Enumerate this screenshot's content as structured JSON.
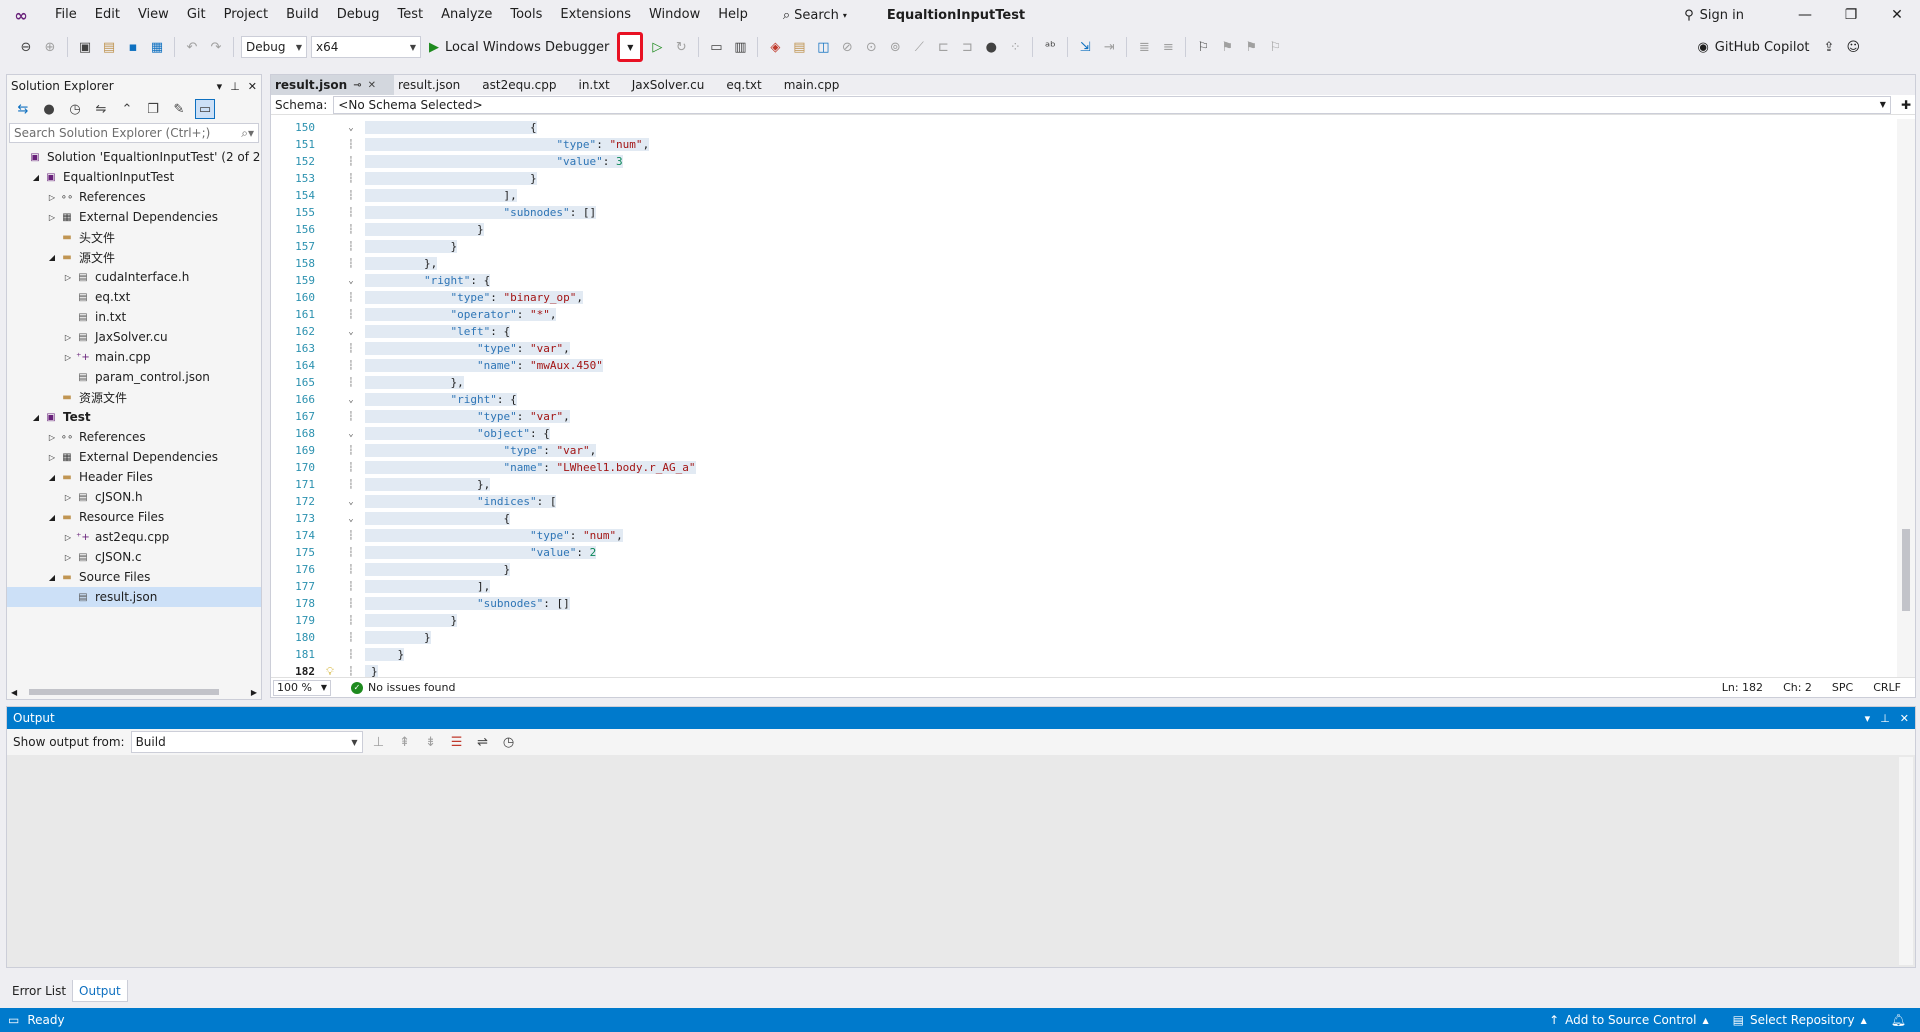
{
  "menu": {
    "items": [
      "File",
      "Edit",
      "View",
      "Git",
      "Project",
      "Build",
      "Debug",
      "Test",
      "Analyze",
      "Tools",
      "Extensions",
      "Window",
      "Help"
    ],
    "search_label": "Search",
    "project_title": "EqualtionInputTest",
    "sign_in": "Sign in"
  },
  "toolbar": {
    "config": "Debug",
    "platform": "x64",
    "run_label": "Local Windows Debugger",
    "copilot_label": "GitHub Copilot"
  },
  "solution_explorer": {
    "title": "Solution Explorer",
    "search_placeholder": "Search Solution Explorer (Ctrl+;)",
    "tree": [
      {
        "label": "Solution 'EqualtionInputTest' (2 of 2 projects)",
        "depth": 0,
        "twisty": "",
        "icon": "solution-icon",
        "bold": false
      },
      {
        "label": "EqualtionInputTest",
        "depth": 1,
        "twisty": "open",
        "icon": "project-icon",
        "bold": false
      },
      {
        "label": "References",
        "depth": 2,
        "twisty": "closed",
        "icon": "references-icon",
        "bold": false
      },
      {
        "label": "External Dependencies",
        "depth": 2,
        "twisty": "closed",
        "icon": "external-deps-icon",
        "bold": false
      },
      {
        "label": "头文件",
        "depth": 2,
        "twisty": "",
        "icon": "folder-icon",
        "bold": false
      },
      {
        "label": "源文件",
        "depth": 2,
        "twisty": "open",
        "icon": "folder-icon",
        "bold": false
      },
      {
        "label": "cudaInterface.h",
        "depth": 3,
        "twisty": "closed",
        "icon": "file-icon",
        "bold": false
      },
      {
        "label": "eq.txt",
        "depth": 3,
        "twisty": "",
        "icon": "file-icon",
        "bold": false
      },
      {
        "label": "in.txt",
        "depth": 3,
        "twisty": "",
        "icon": "file-icon",
        "bold": false
      },
      {
        "label": "JaxSolver.cu",
        "depth": 3,
        "twisty": "closed",
        "icon": "file-icon",
        "bold": false
      },
      {
        "label": "main.cpp",
        "depth": 3,
        "twisty": "closed",
        "icon": "cpp-icon",
        "bold": false
      },
      {
        "label": "param_control.json",
        "depth": 3,
        "twisty": "",
        "icon": "file-icon",
        "bold": false
      },
      {
        "label": "资源文件",
        "depth": 2,
        "twisty": "",
        "icon": "folder-icon",
        "bold": false
      },
      {
        "label": "Test",
        "depth": 1,
        "twisty": "open",
        "icon": "project-icon",
        "bold": true
      },
      {
        "label": "References",
        "depth": 2,
        "twisty": "closed",
        "icon": "references-icon",
        "bold": false
      },
      {
        "label": "External Dependencies",
        "depth": 2,
        "twisty": "closed",
        "icon": "external-deps-icon",
        "bold": false
      },
      {
        "label": "Header Files",
        "depth": 2,
        "twisty": "open",
        "icon": "folder-icon",
        "bold": false
      },
      {
        "label": "cJSON.h",
        "depth": 3,
        "twisty": "closed",
        "icon": "file-icon",
        "bold": false
      },
      {
        "label": "Resource Files",
        "depth": 2,
        "twisty": "open",
        "icon": "folder-icon",
        "bold": false
      },
      {
        "label": "ast2equ.cpp",
        "depth": 3,
        "twisty": "closed",
        "icon": "cpp-icon",
        "bold": false
      },
      {
        "label": "cJSON.c",
        "depth": 3,
        "twisty": "closed",
        "icon": "file-icon",
        "bold": false
      },
      {
        "label": "Source Files",
        "depth": 2,
        "twisty": "open",
        "icon": "folder-icon",
        "bold": false
      },
      {
        "label": "result.json",
        "depth": 3,
        "twisty": "",
        "icon": "file-icon",
        "bold": false,
        "selected": true
      }
    ]
  },
  "editor": {
    "tabs": [
      {
        "label": "result.json",
        "active": true
      },
      {
        "label": "result.json",
        "active": false
      },
      {
        "label": "ast2equ.cpp",
        "active": false
      },
      {
        "label": "in.txt",
        "active": false
      },
      {
        "label": "JaxSolver.cu",
        "active": false
      },
      {
        "label": "eq.txt",
        "active": false
      },
      {
        "label": "main.cpp",
        "active": false
      }
    ],
    "schema_label": "Schema:",
    "schema_value": "<No Schema Selected>",
    "lines": [
      {
        "n": "150",
        "fold": "v",
        "text": "                        {"
      },
      {
        "n": "151",
        "fold": "",
        "text": "                            \"type\": \"num\","
      },
      {
        "n": "152",
        "fold": "",
        "text": "                            \"value\": 3"
      },
      {
        "n": "153",
        "fold": "",
        "text": "                        }"
      },
      {
        "n": "154",
        "fold": "",
        "text": "                    ],"
      },
      {
        "n": "155",
        "fold": "",
        "text": "                    \"subnodes\": []"
      },
      {
        "n": "156",
        "fold": "",
        "text": "                }"
      },
      {
        "n": "157",
        "fold": "",
        "text": "            }"
      },
      {
        "n": "158",
        "fold": "",
        "text": "        },"
      },
      {
        "n": "159",
        "fold": "v",
        "text": "        \"right\": {"
      },
      {
        "n": "160",
        "fold": "",
        "text": "            \"type\": \"binary_op\","
      },
      {
        "n": "161",
        "fold": "",
        "text": "            \"operator\": \"*\","
      },
      {
        "n": "162",
        "fold": "v",
        "text": "            \"left\": {"
      },
      {
        "n": "163",
        "fold": "",
        "text": "                \"type\": \"var\","
      },
      {
        "n": "164",
        "fold": "",
        "text": "                \"name\": \"mwAux.450\""
      },
      {
        "n": "165",
        "fold": "",
        "text": "            },"
      },
      {
        "n": "166",
        "fold": "v",
        "text": "            \"right\": {"
      },
      {
        "n": "167",
        "fold": "",
        "text": "                \"type\": \"var\","
      },
      {
        "n": "168",
        "fold": "v",
        "text": "                \"object\": {"
      },
      {
        "n": "169",
        "fold": "",
        "text": "                    \"type\": \"var\","
      },
      {
        "n": "170",
        "fold": "",
        "text": "                    \"name\": \"LWheel1.body.r_AG_a\""
      },
      {
        "n": "171",
        "fold": "",
        "text": "                },"
      },
      {
        "n": "172",
        "fold": "v",
        "text": "                \"indices\": ["
      },
      {
        "n": "173",
        "fold": "v",
        "text": "                    {"
      },
      {
        "n": "174",
        "fold": "",
        "text": "                        \"type\": \"num\","
      },
      {
        "n": "175",
        "fold": "",
        "text": "                        \"value\": 2"
      },
      {
        "n": "176",
        "fold": "",
        "text": "                    }"
      },
      {
        "n": "177",
        "fold": "",
        "text": "                ],"
      },
      {
        "n": "178",
        "fold": "",
        "text": "                \"subnodes\": []"
      },
      {
        "n": "179",
        "fold": "",
        "text": "            }"
      },
      {
        "n": "180",
        "fold": "",
        "text": "        }"
      },
      {
        "n": "181",
        "fold": "",
        "text": "    }"
      },
      {
        "n": "182",
        "fold": "",
        "text": "}",
        "current": true
      }
    ],
    "zoom": "100 %",
    "issues": "No issues found",
    "ln": "Ln: 182",
    "ch": "Ch: 2",
    "spc": "SPC",
    "crlf": "CRLF"
  },
  "output": {
    "title": "Output",
    "show_from_label": "Show output from:",
    "source": "Build"
  },
  "bottom_tabs": [
    "Error List",
    "Output"
  ],
  "status": {
    "ready": "Ready",
    "source_control": "Add to Source Control",
    "repository": "Select Repository"
  }
}
